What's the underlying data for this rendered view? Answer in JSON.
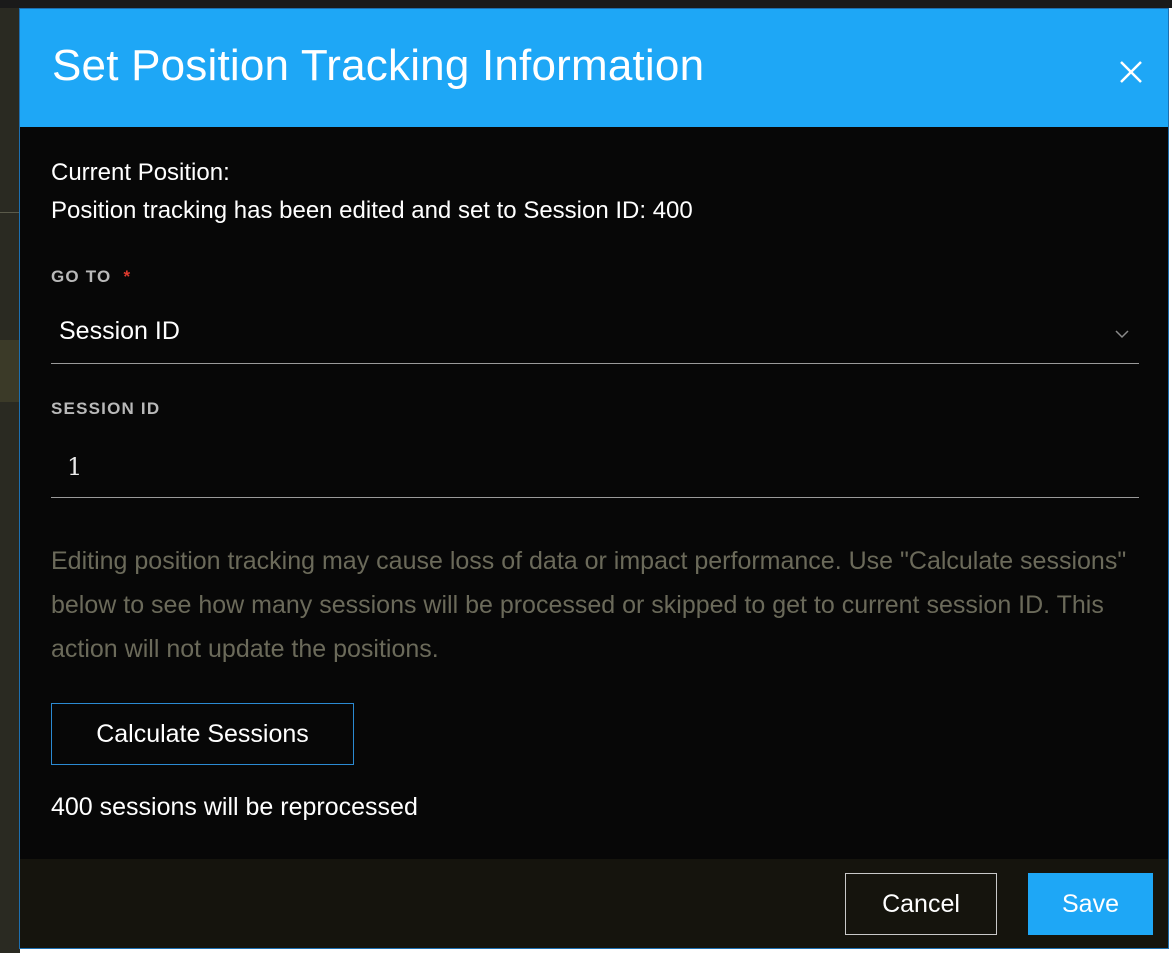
{
  "dialog": {
    "title": "Set Position Tracking Information",
    "close_icon": "close-icon"
  },
  "current_position": {
    "label": "Current Position:",
    "text": "Position tracking has been edited and set to Session ID: 400"
  },
  "go_to": {
    "label": "GO TO",
    "required_marker": "*",
    "selected": "Session ID",
    "chevron_icon": "chevron-down-icon"
  },
  "session_id": {
    "label": "SESSION ID",
    "value": "1"
  },
  "warning": {
    "text": "Editing position tracking may cause loss of data or impact performance. Use \"Calculate sessions\" below to see how many sessions will be processed or skipped to get to current session ID. This action will not update the positions."
  },
  "calculate_button": {
    "label": "Calculate Sessions"
  },
  "result": {
    "text": "400 sessions will be reprocessed"
  },
  "footer": {
    "cancel_label": "Cancel",
    "save_label": "Save"
  },
  "colors": {
    "accent": "#1ea7f6",
    "dialog_bg": "#070707",
    "footer_bg": "#15140d",
    "required": "#e03a2e",
    "warning_text": "#6b6a5a"
  }
}
